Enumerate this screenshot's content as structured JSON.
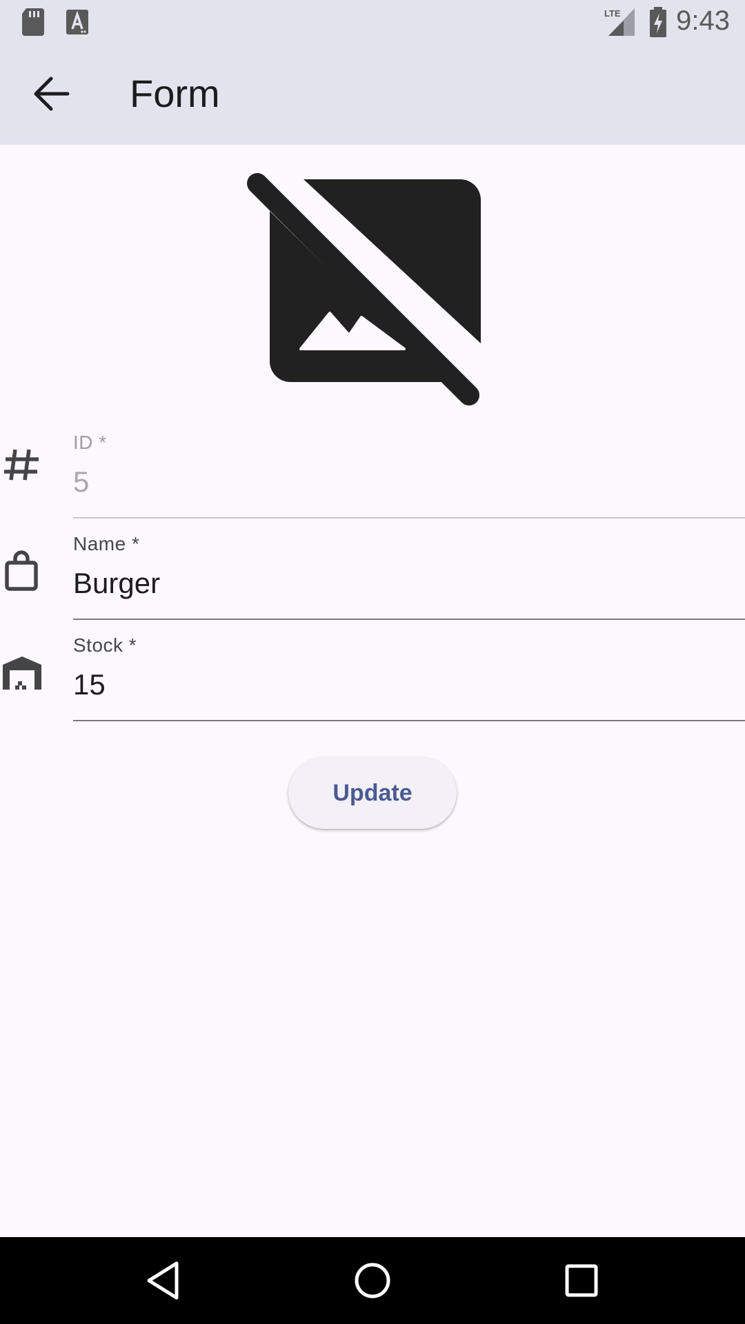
{
  "status_bar": {
    "time": "9:43",
    "icons": [
      "sd-card-icon",
      "keyboard-a-icon",
      "lte-signal-icon",
      "battery-charging-icon"
    ]
  },
  "app_bar": {
    "back_icon": "arrow-back-icon",
    "title": "Form"
  },
  "image_placeholder": {
    "icon": "hide-image-icon"
  },
  "form": {
    "fields": [
      {
        "icon": "tag-icon",
        "label": "ID *",
        "value": "5",
        "enabled": false
      },
      {
        "icon": "shopping-bag-icon",
        "label": "Name *",
        "value": "Burger",
        "enabled": true
      },
      {
        "icon": "warehouse-icon",
        "label": "Stock *",
        "value": "15",
        "enabled": true
      }
    ],
    "submit_label": "Update"
  },
  "nav_bar": {
    "buttons": [
      "nav-back-icon",
      "nav-home-icon",
      "nav-recents-icon"
    ]
  },
  "colors": {
    "app_bar_bg": "#e3e3ee",
    "page_bg": "#fbf8fe",
    "button_text": "#4b5a92"
  }
}
